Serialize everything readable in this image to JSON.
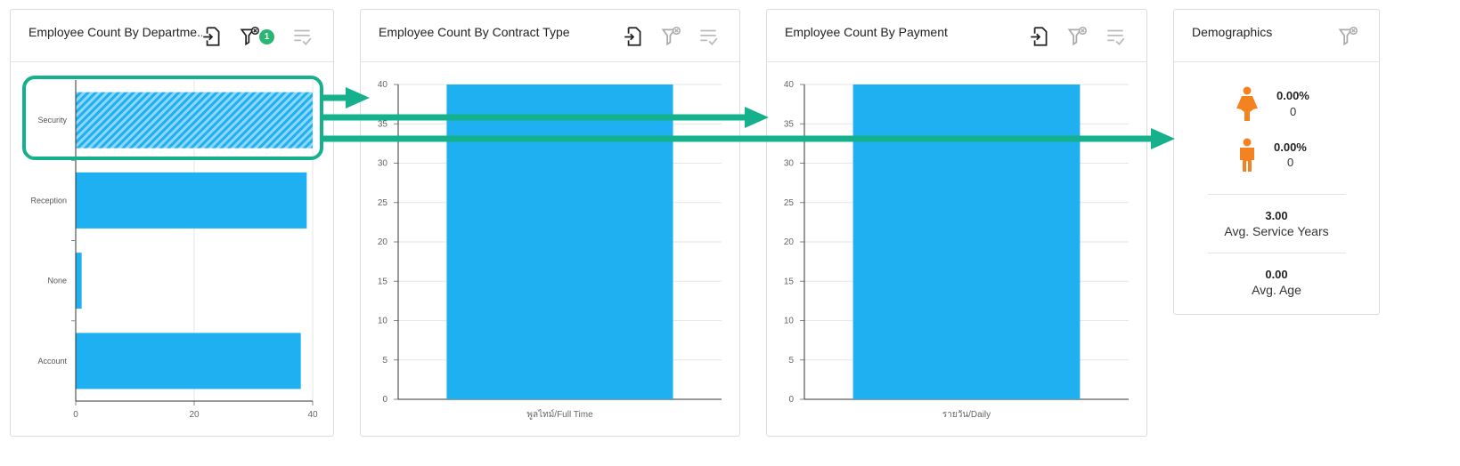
{
  "colors": {
    "bar": "#1fb0f2",
    "accent": "#15b08c",
    "person": "#f48220",
    "badge": "#2bb673"
  },
  "cards": {
    "department": {
      "title": "Employee Count By Departme...",
      "filter_badge": "1",
      "icons": [
        "export-icon",
        "filter-clear-icon",
        "checklist-icon"
      ]
    },
    "contract": {
      "title": "Employee Count By Contract Type",
      "icons": [
        "export-icon",
        "filter-clear-icon",
        "checklist-icon"
      ]
    },
    "payment": {
      "title": "Employee Count By Payment",
      "icons": [
        "export-icon",
        "filter-clear-icon",
        "checklist-icon"
      ]
    },
    "demographics": {
      "title": "Demographics",
      "icons": [
        "filter-clear-icon"
      ],
      "female_pct": "0.00%",
      "female_count": "0",
      "male_pct": "0.00%",
      "male_count": "0",
      "service_years_value": "3.00",
      "service_years_label": "Avg. Service Years",
      "age_value": "0.00",
      "age_label": "Avg. Age"
    }
  },
  "chart_data": [
    {
      "type": "bar",
      "orientation": "horizontal",
      "categories": [
        "Security",
        "Reception",
        "None",
        "Account"
      ],
      "values": [
        40,
        39,
        1,
        38
      ],
      "xticks": [
        "0",
        "20",
        "40"
      ],
      "xlim": [
        0,
        40
      ],
      "highlighted": "Security",
      "title": "",
      "xlabel": "",
      "ylabel": ""
    },
    {
      "type": "bar",
      "categories": [
        "พูลไทม์/Full Time"
      ],
      "values": [
        40
      ],
      "yticks": [
        "0",
        "5",
        "10",
        "15",
        "20",
        "25",
        "30",
        "35",
        "40"
      ],
      "ylim": [
        0,
        40
      ],
      "grid": true
    },
    {
      "type": "bar",
      "categories": [
        "รายวัน/Daily"
      ],
      "values": [
        40
      ],
      "yticks": [
        "0",
        "5",
        "10",
        "15",
        "20",
        "25",
        "30",
        "35",
        "40"
      ],
      "ylim": [
        0,
        40
      ],
      "grid": true
    }
  ]
}
